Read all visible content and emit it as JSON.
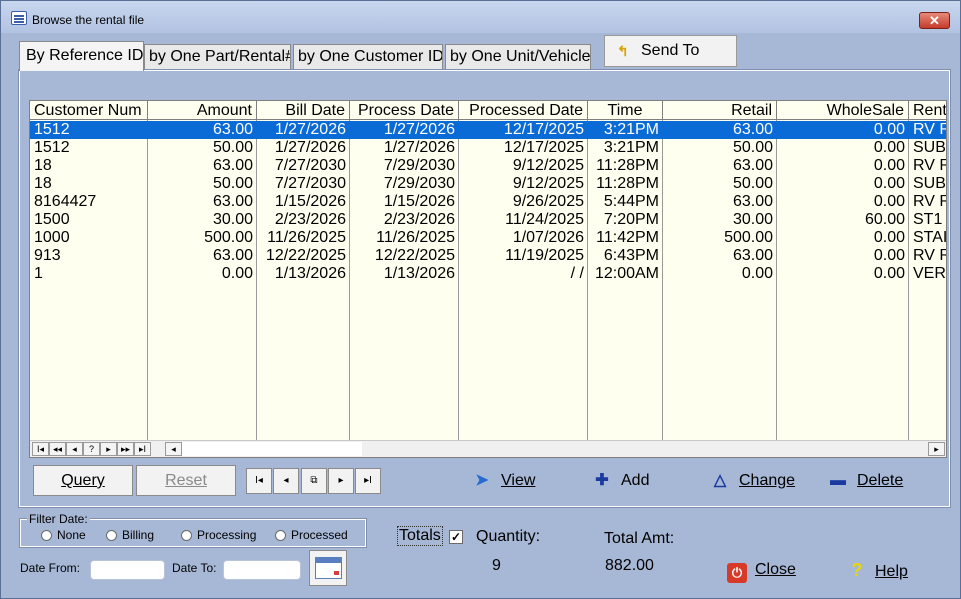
{
  "window": {
    "title": "Browse the rental file",
    "close_glyph": "✕"
  },
  "tabs": [
    {
      "label": "By Reference ID"
    },
    {
      "label": "by One Part/Rental#"
    },
    {
      "label": "by One Customer ID"
    },
    {
      "label": "by One Unit/Vehicle"
    }
  ],
  "send_to": {
    "label": "Send To",
    "icon": "send-arrow-icon"
  },
  "grid": {
    "columns": [
      "Customer Num",
      "Amount",
      "Bill Date",
      "Process Date",
      "Processed Date",
      "Time",
      "Retail",
      "WholeSale",
      "Rent"
    ],
    "rows": [
      [
        "1512",
        "63.00",
        "1/27/2026",
        "1/27/2026",
        "12/17/2025",
        "3:21PM",
        "63.00",
        "0.00",
        "RV R"
      ],
      [
        "1512",
        "50.00",
        "1/27/2026",
        "1/27/2026",
        "12/17/2025",
        "3:21PM",
        "50.00",
        "0.00",
        "SUB"
      ],
      [
        "18",
        "63.00",
        "7/27/2030",
        "7/29/2030",
        "9/12/2025",
        "11:28PM",
        "63.00",
        "0.00",
        "RV R"
      ],
      [
        "18",
        "50.00",
        "7/27/2030",
        "7/29/2030",
        "9/12/2025",
        "11:28PM",
        "50.00",
        "0.00",
        "SUB"
      ],
      [
        "8164427",
        "63.00",
        "1/15/2026",
        "1/15/2026",
        "9/26/2025",
        "5:44PM",
        "63.00",
        "0.00",
        "RV R"
      ],
      [
        "1500",
        "30.00",
        "2/23/2026",
        "2/23/2026",
        "11/24/2025",
        "7:20PM",
        "30.00",
        "60.00",
        "ST1"
      ],
      [
        "1000",
        "500.00",
        "11/26/2025",
        "11/26/2025",
        "1/07/2026",
        "11:42PM",
        "500.00",
        "0.00",
        "STAI"
      ],
      [
        "913",
        "63.00",
        "12/22/2025",
        "12/22/2025",
        "11/19/2025",
        "6:43PM",
        "63.00",
        "0.00",
        "RV R"
      ],
      [
        "1",
        "0.00",
        "1/13/2026",
        "1/13/2026",
        "/ /",
        "12:00AM",
        "0.00",
        "0.00",
        "VER"
      ]
    ],
    "nav_buttons": [
      "I◂",
      "◂◂",
      "◂",
      "?",
      "▸",
      "▸▸",
      "▸I"
    ],
    "scroll_left": "◂",
    "scroll_right": "▸"
  },
  "buttons": {
    "query": "Query",
    "reset": "Reset",
    "record_nav": [
      "I◂",
      "◂",
      "⧉",
      "▸",
      "▸I"
    ]
  },
  "actions": {
    "view": {
      "label": "View",
      "glyph": "➤"
    },
    "add": {
      "label": "Add",
      "glyph": "✚"
    },
    "change": {
      "label": "Change",
      "glyph": "△"
    },
    "delete": {
      "label": "Delete",
      "glyph": "▬"
    }
  },
  "filter": {
    "legend": "Filter Date:",
    "options": [
      "None",
      "Billing",
      "Processing",
      "Processed"
    ],
    "date_from_label": "Date From:",
    "date_to_label": "Date To:",
    "date_from_value": "",
    "date_to_value": ""
  },
  "totals": {
    "label": "Totals",
    "checked_glyph": "✓",
    "quantity_label": "Quantity:",
    "quantity_value": "9",
    "total_amt_label": "Total Amt:",
    "total_amt_value": "882.00"
  },
  "footer": {
    "close_label": "Close",
    "close_glyph": "⏻",
    "help_label": "Help",
    "help_glyph": "?"
  },
  "colors": {
    "window_bg": "#a7b8d6",
    "grid_bg": "#fffff0",
    "selection": "#0a6ad6"
  }
}
